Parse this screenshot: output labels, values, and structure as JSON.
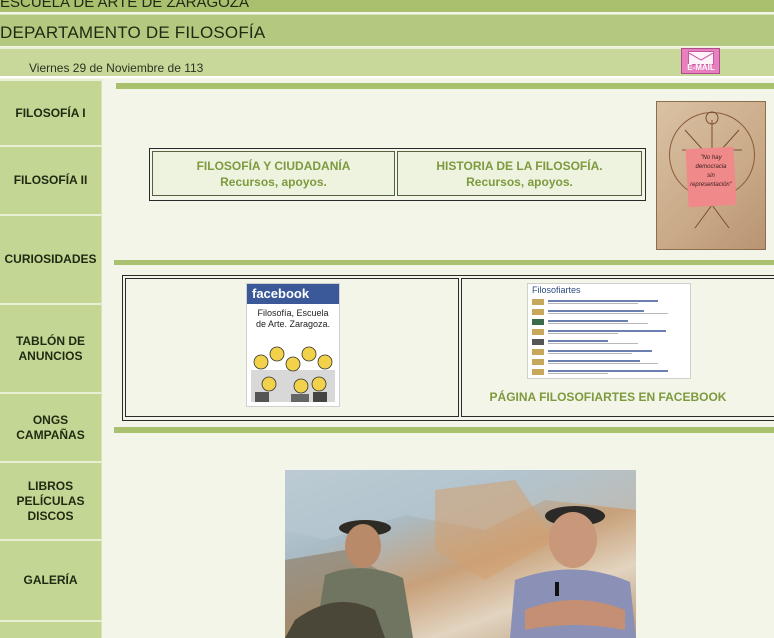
{
  "header": {
    "school": "ESCUELA DE ARTE DE ZARAGOZA",
    "department": "DEPARTAMENTO DE FILOSOFÍA",
    "date": "Viernes 29 de Noviembre de 113",
    "email_label": "E-MAIL"
  },
  "nav": [
    {
      "label": "FILOSOFÍA I"
    },
    {
      "label": "FILOSOFÍA II"
    },
    {
      "label": "CURIOSIDADES"
    },
    {
      "label": "TABLÓN DE\nANUNCIOS"
    },
    {
      "label": "ONGS\nCAMPAÑAS"
    },
    {
      "label": "LIBROS\nPELÍCULAS\nDISCOS"
    },
    {
      "label": "GALERÍA"
    }
  ],
  "links": [
    {
      "label": "FILOSOFÍA Y CIUDADANÍA\nRecursos, apoyos."
    },
    {
      "label": "HISTORIA DE LA FILOSOFÍA.\nRecursos, apoyos."
    }
  ],
  "poster": {
    "quote": "\"No hay\ndemocracia\nsin\nrepresentación\""
  },
  "facebook": {
    "logo": "facebook",
    "caption": "Filosofía, Escuela\nde Arte. Zaragoza.",
    "page_title": "Filosofiartes",
    "page_link": "PÁGINA FILOSOFIARTES EN FACEBOOK"
  },
  "colors": {
    "accent": "#a9c06e",
    "nav_bg": "#c4d693",
    "link_text": "#7d9a3e",
    "facebook_blue": "#3b5998"
  },
  "icons": [
    "email-icon"
  ]
}
